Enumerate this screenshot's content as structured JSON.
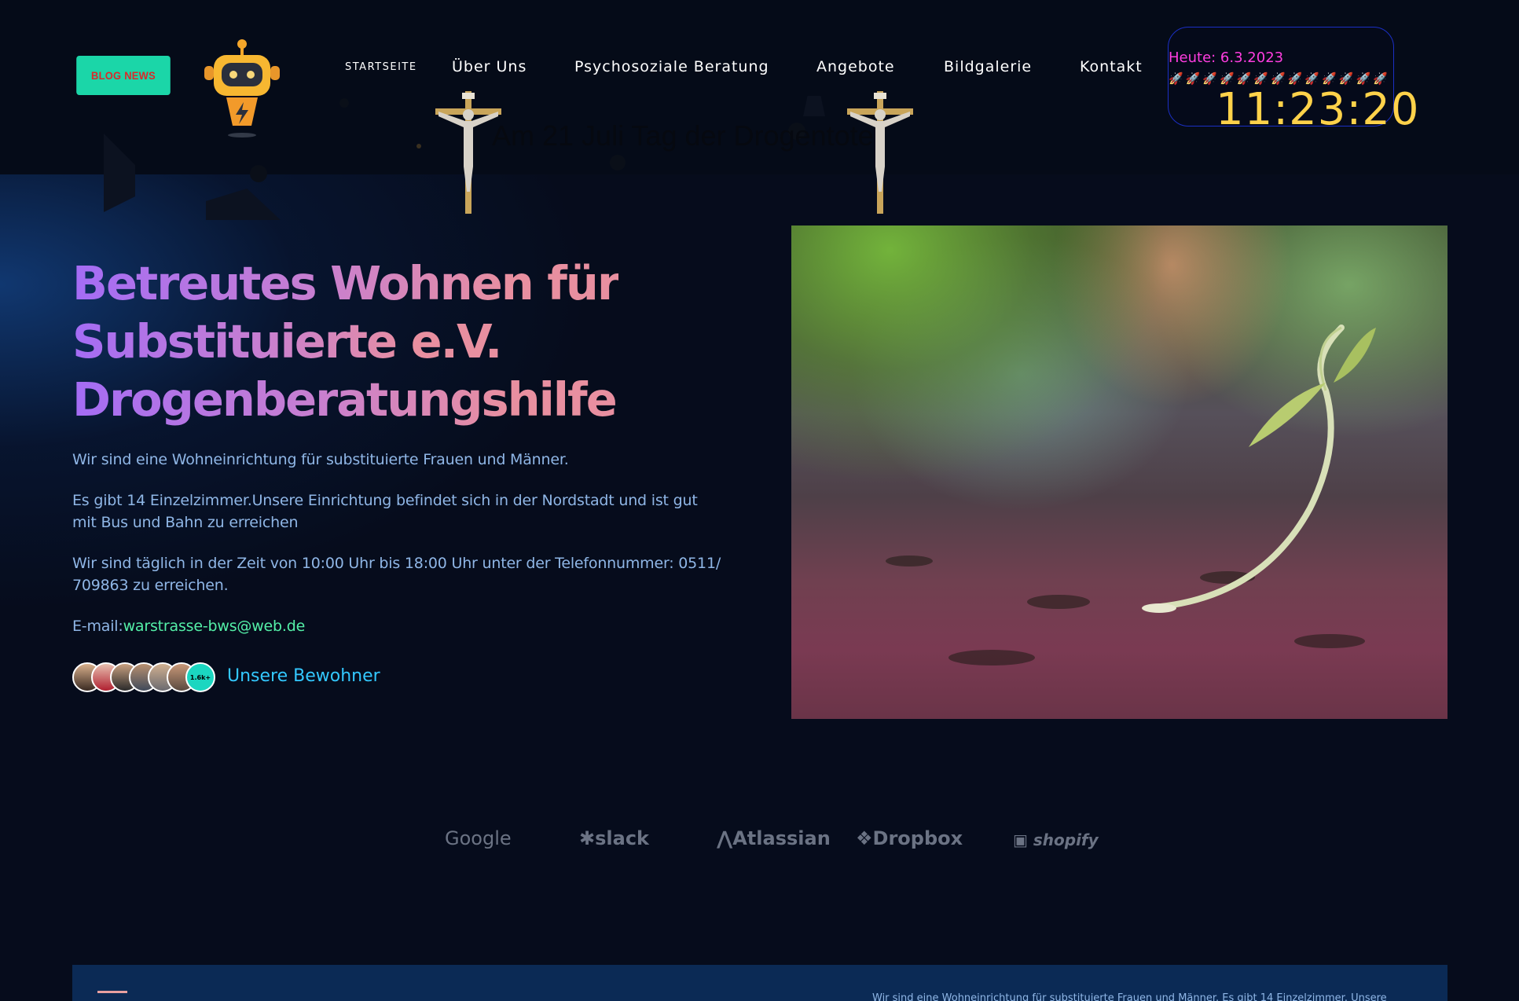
{
  "header": {
    "blog_button": "BLOG NEWS",
    "nav": [
      "STARTSEITE",
      "Über Uns",
      "Psychosoziale Beratung",
      "Angebote",
      "Bildgalerie",
      "Kontakt"
    ]
  },
  "clock": {
    "date": "Heute: 6.3.2023",
    "rockets": "🚀🚀🚀🚀🚀🚀🚀🚀🚀🚀🚀🚀🚀",
    "time": "11:23:20"
  },
  "memorial_text": "Am 21 Juli Tag der Drogentote",
  "hero": {
    "title_line1": "Betreutes Wohnen für",
    "title_line2": "Substituierte e.V.",
    "title_line3": "Drogenberatungshilfe",
    "p1": "Wir sind eine Wohneinrichtung für substituierte Frauen und Männer.",
    "p2": "Es gibt 14 Einzelzimmer.Unsere Einrichtung befindet sich in der Nordstadt und ist gut mit Bus und Bahn zu erreichen",
    "p3": "Wir sind täglich in der Zeit von 10:00 Uhr bis 18:00 Uhr unter der Telefonnummer: 0511/ 709863 zu erreichen.",
    "email_label": "E-mail:",
    "email": "warstrasse-bws@web.de",
    "avatar_count": "1.6k+",
    "residents_link": "Unsere Bewohner"
  },
  "partners": [
    "Google",
    "slack",
    "Atlassian",
    "Dropbox",
    "shopify"
  ],
  "footer": {
    "text": "Wir sind eine Wohneinrichtung für substituierte Frauen und Männer. Es gibt 14 Einzelzimmer. Unsere"
  },
  "colors": {
    "background": "#060c1c",
    "accent_green": "#1bd6a8",
    "title_gradient_start": "#a46cf5",
    "title_gradient_end": "#e88fa0",
    "text_blue": "#8fb6e6",
    "link_cyan": "#33c8ff",
    "clock_yellow": "#ffd24a",
    "clock_magenta": "#ff3de0"
  }
}
